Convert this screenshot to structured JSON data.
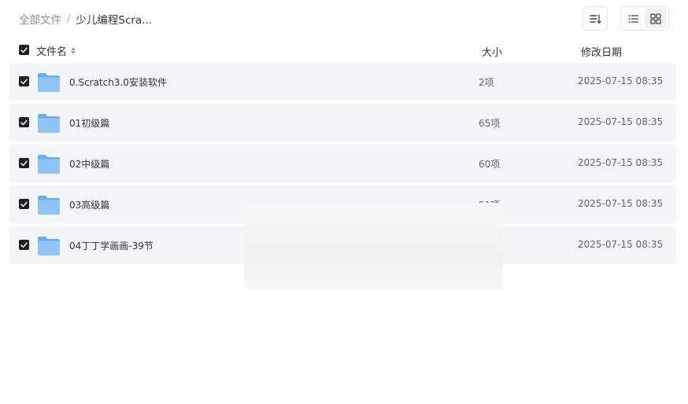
{
  "breadcrumb": {
    "root": "全部文件",
    "separator": "/",
    "current": "少儿编程Scra..."
  },
  "toolbar": {
    "sort_icon": "sort-lines-icon",
    "list_icon": "list-view-icon",
    "grid_icon": "grid-view-icon"
  },
  "header": {
    "name": "文件名",
    "size": "大小",
    "date": "修改日期"
  },
  "files": [
    {
      "name": "0.Scratch3.0安装软件",
      "size": "2项",
      "date": "2025-07-15 08:35"
    },
    {
      "name": "01初级篇",
      "size": "65项",
      "date": "2025-07-15 08:35"
    },
    {
      "name": "02中级篇",
      "size": "60项",
      "date": "2025-07-15 08:35"
    },
    {
      "name": "03高级篇",
      "size": "51项",
      "date": "2025-07-15 08:35"
    },
    {
      "name": "04丁丁学画画-39节",
      "size": "",
      "date": "2025-07-15 08:35"
    }
  ],
  "colors": {
    "row_bg": "#f4f5f7",
    "folder_front": "#8ec5f6",
    "folder_back": "#6aaeea",
    "checkbox": "#1f1f1f"
  }
}
